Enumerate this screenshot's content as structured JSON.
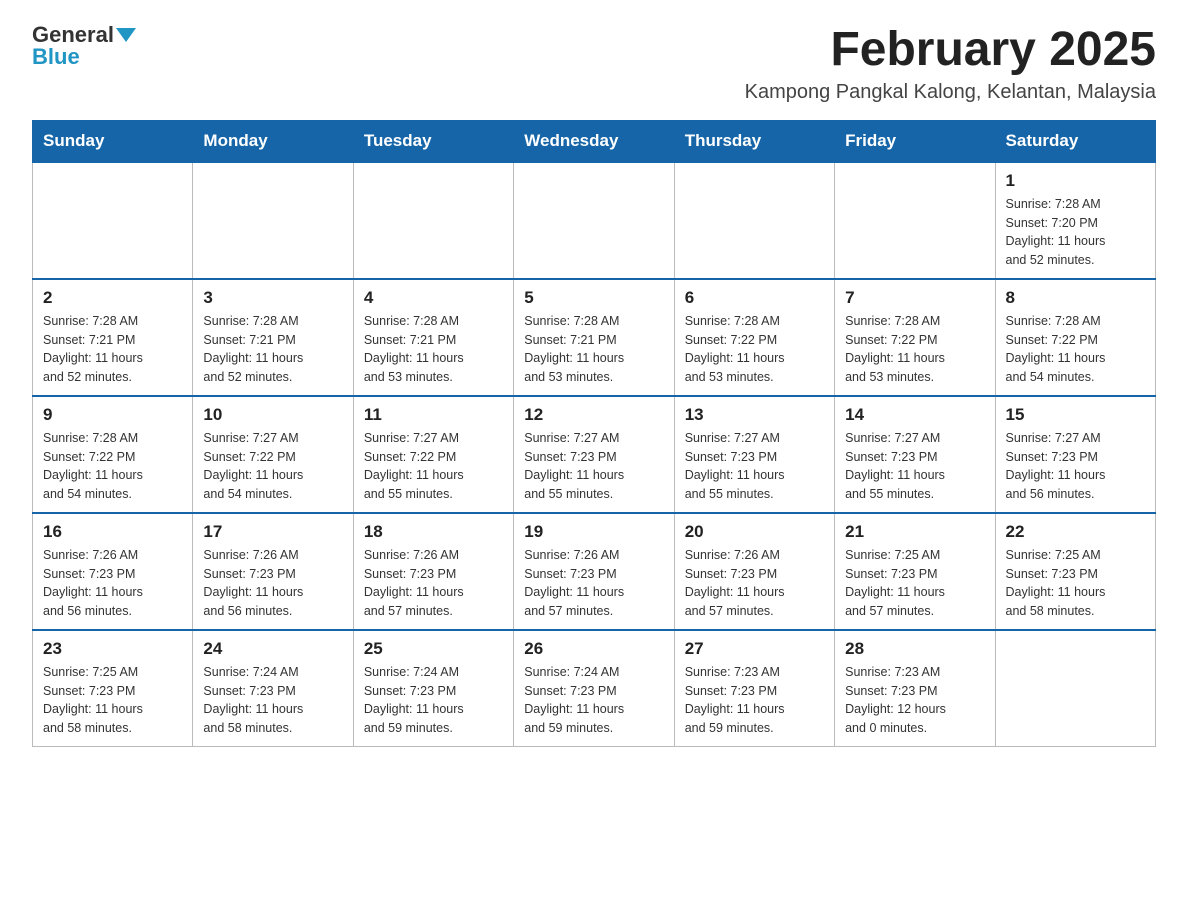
{
  "header": {
    "logo_general": "General",
    "logo_blue": "Blue",
    "title": "February 2025",
    "subtitle": "Kampong Pangkal Kalong, Kelantan, Malaysia"
  },
  "days_of_week": [
    "Sunday",
    "Monday",
    "Tuesday",
    "Wednesday",
    "Thursday",
    "Friday",
    "Saturday"
  ],
  "weeks": [
    [
      {
        "day": "",
        "info": ""
      },
      {
        "day": "",
        "info": ""
      },
      {
        "day": "",
        "info": ""
      },
      {
        "day": "",
        "info": ""
      },
      {
        "day": "",
        "info": ""
      },
      {
        "day": "",
        "info": ""
      },
      {
        "day": "1",
        "info": "Sunrise: 7:28 AM\nSunset: 7:20 PM\nDaylight: 11 hours\nand 52 minutes."
      }
    ],
    [
      {
        "day": "2",
        "info": "Sunrise: 7:28 AM\nSunset: 7:21 PM\nDaylight: 11 hours\nand 52 minutes."
      },
      {
        "day": "3",
        "info": "Sunrise: 7:28 AM\nSunset: 7:21 PM\nDaylight: 11 hours\nand 52 minutes."
      },
      {
        "day": "4",
        "info": "Sunrise: 7:28 AM\nSunset: 7:21 PM\nDaylight: 11 hours\nand 53 minutes."
      },
      {
        "day": "5",
        "info": "Sunrise: 7:28 AM\nSunset: 7:21 PM\nDaylight: 11 hours\nand 53 minutes."
      },
      {
        "day": "6",
        "info": "Sunrise: 7:28 AM\nSunset: 7:22 PM\nDaylight: 11 hours\nand 53 minutes."
      },
      {
        "day": "7",
        "info": "Sunrise: 7:28 AM\nSunset: 7:22 PM\nDaylight: 11 hours\nand 53 minutes."
      },
      {
        "day": "8",
        "info": "Sunrise: 7:28 AM\nSunset: 7:22 PM\nDaylight: 11 hours\nand 54 minutes."
      }
    ],
    [
      {
        "day": "9",
        "info": "Sunrise: 7:28 AM\nSunset: 7:22 PM\nDaylight: 11 hours\nand 54 minutes."
      },
      {
        "day": "10",
        "info": "Sunrise: 7:27 AM\nSunset: 7:22 PM\nDaylight: 11 hours\nand 54 minutes."
      },
      {
        "day": "11",
        "info": "Sunrise: 7:27 AM\nSunset: 7:22 PM\nDaylight: 11 hours\nand 55 minutes."
      },
      {
        "day": "12",
        "info": "Sunrise: 7:27 AM\nSunset: 7:23 PM\nDaylight: 11 hours\nand 55 minutes."
      },
      {
        "day": "13",
        "info": "Sunrise: 7:27 AM\nSunset: 7:23 PM\nDaylight: 11 hours\nand 55 minutes."
      },
      {
        "day": "14",
        "info": "Sunrise: 7:27 AM\nSunset: 7:23 PM\nDaylight: 11 hours\nand 55 minutes."
      },
      {
        "day": "15",
        "info": "Sunrise: 7:27 AM\nSunset: 7:23 PM\nDaylight: 11 hours\nand 56 minutes."
      }
    ],
    [
      {
        "day": "16",
        "info": "Sunrise: 7:26 AM\nSunset: 7:23 PM\nDaylight: 11 hours\nand 56 minutes."
      },
      {
        "day": "17",
        "info": "Sunrise: 7:26 AM\nSunset: 7:23 PM\nDaylight: 11 hours\nand 56 minutes."
      },
      {
        "day": "18",
        "info": "Sunrise: 7:26 AM\nSunset: 7:23 PM\nDaylight: 11 hours\nand 57 minutes."
      },
      {
        "day": "19",
        "info": "Sunrise: 7:26 AM\nSunset: 7:23 PM\nDaylight: 11 hours\nand 57 minutes."
      },
      {
        "day": "20",
        "info": "Sunrise: 7:26 AM\nSunset: 7:23 PM\nDaylight: 11 hours\nand 57 minutes."
      },
      {
        "day": "21",
        "info": "Sunrise: 7:25 AM\nSunset: 7:23 PM\nDaylight: 11 hours\nand 57 minutes."
      },
      {
        "day": "22",
        "info": "Sunrise: 7:25 AM\nSunset: 7:23 PM\nDaylight: 11 hours\nand 58 minutes."
      }
    ],
    [
      {
        "day": "23",
        "info": "Sunrise: 7:25 AM\nSunset: 7:23 PM\nDaylight: 11 hours\nand 58 minutes."
      },
      {
        "day": "24",
        "info": "Sunrise: 7:24 AM\nSunset: 7:23 PM\nDaylight: 11 hours\nand 58 minutes."
      },
      {
        "day": "25",
        "info": "Sunrise: 7:24 AM\nSunset: 7:23 PM\nDaylight: 11 hours\nand 59 minutes."
      },
      {
        "day": "26",
        "info": "Sunrise: 7:24 AM\nSunset: 7:23 PM\nDaylight: 11 hours\nand 59 minutes."
      },
      {
        "day": "27",
        "info": "Sunrise: 7:23 AM\nSunset: 7:23 PM\nDaylight: 11 hours\nand 59 minutes."
      },
      {
        "day": "28",
        "info": "Sunrise: 7:23 AM\nSunset: 7:23 PM\nDaylight: 12 hours\nand 0 minutes."
      },
      {
        "day": "",
        "info": ""
      }
    ]
  ]
}
